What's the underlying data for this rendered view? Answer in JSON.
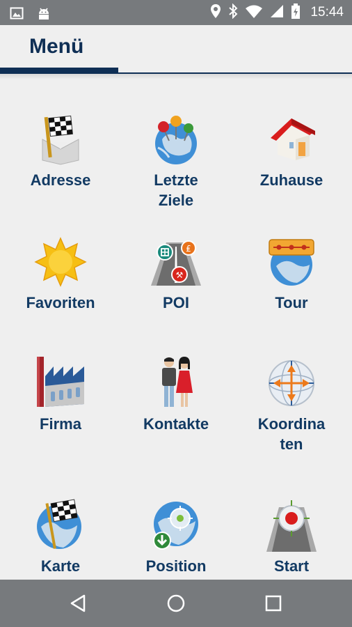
{
  "status_bar": {
    "time": "15:44",
    "icons": [
      "image-icon",
      "android-icon",
      "location-icon",
      "bluetooth-icon",
      "wifi-icon",
      "signal-icon",
      "battery-icon"
    ]
  },
  "header": {
    "title": "Menü"
  },
  "menu": {
    "items": [
      {
        "label": "Adresse",
        "icon": "checkered-flag-icon"
      },
      {
        "label": "Letzte\nZiele",
        "icon": "globe-pins-icon"
      },
      {
        "label": "Zuhause",
        "icon": "house-icon"
      },
      {
        "label": "Favoriten",
        "icon": "star-icon"
      },
      {
        "label": "POI",
        "icon": "poi-road-icon"
      },
      {
        "label": "Tour",
        "icon": "tour-globe-icon"
      },
      {
        "label": "Firma",
        "icon": "factory-icon"
      },
      {
        "label": "Kontakte",
        "icon": "contacts-icon"
      },
      {
        "label": "Koordina\nten",
        "icon": "coordinates-icon"
      },
      {
        "label": "Karte",
        "icon": "map-globe-flag-icon"
      },
      {
        "label": "Position",
        "icon": "position-globe-icon"
      },
      {
        "label": "Start\nGPS",
        "icon": "gps-start-icon"
      }
    ]
  },
  "colors": {
    "accent": "#0f2f55",
    "label": "#123a63",
    "bars": "#777a7d",
    "background": "#efefef"
  }
}
